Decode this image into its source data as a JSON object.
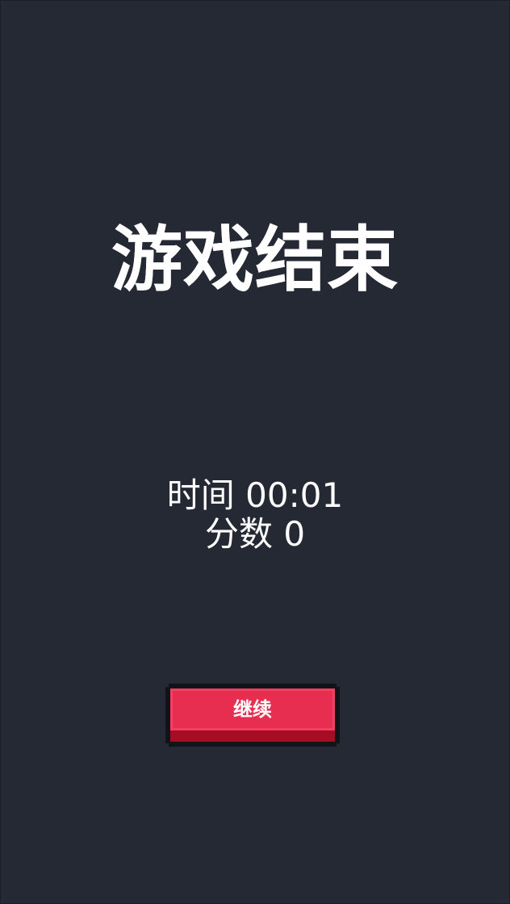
{
  "screen": {
    "background_color": "#252934"
  },
  "game_over": {
    "title": "游戏结束",
    "time_label": "时间",
    "time_value": "00:01",
    "score_label": "分数",
    "score_value": "0"
  },
  "continue_button": {
    "label": "继续",
    "face_color": "#e72e50",
    "shadow_color": "#a50d25",
    "outline_color": "#111318"
  }
}
